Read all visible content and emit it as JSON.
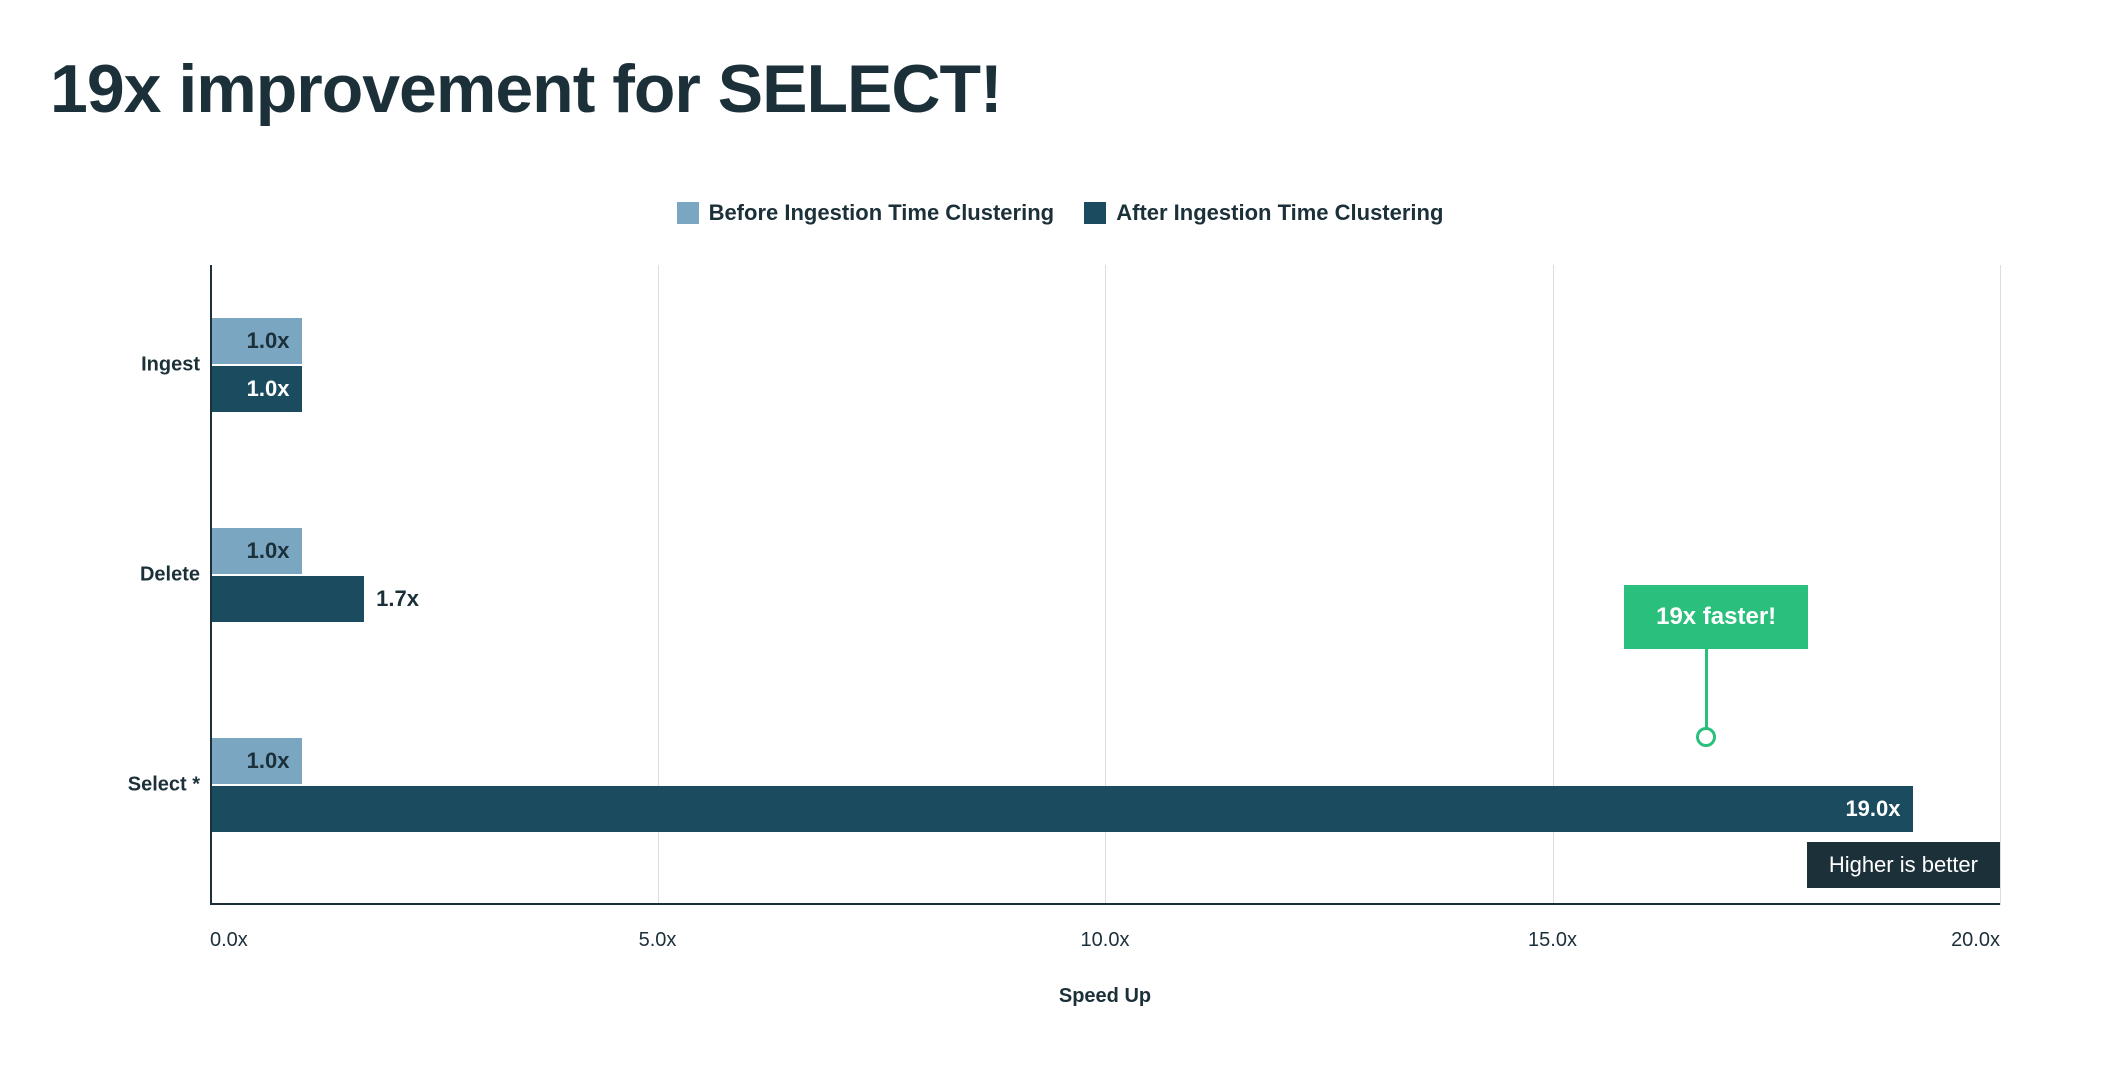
{
  "title": "19x improvement for SELECT!",
  "legend": {
    "before": "Before Ingestion Time Clustering",
    "after": "After Ingestion Time Clustering"
  },
  "colors": {
    "before": "#7ba6c2",
    "after": "#1a4b5e",
    "accent": "#2bbf7e"
  },
  "x_axis": {
    "title": "Speed Up",
    "ticks": [
      "0.0x",
      "5.0x",
      "10.0x",
      "15.0x",
      "20.0x"
    ]
  },
  "categories": [
    "Ingest",
    "Delete",
    "Select *"
  ],
  "bars": {
    "ingest_before": "1.0x",
    "ingest_after": "1.0x",
    "delete_before": "1.0x",
    "delete_after": "1.7x",
    "select_before": "1.0x",
    "select_after": "19.0x"
  },
  "annotation": "19x faster!",
  "higher_is_better": "Higher is better",
  "chart_data": {
    "type": "bar",
    "orientation": "horizontal",
    "title": "19x improvement for SELECT!",
    "xlabel": "Speed Up",
    "ylabel": "",
    "xlim": [
      0,
      20
    ],
    "categories": [
      "Ingest",
      "Delete",
      "Select *"
    ],
    "series": [
      {
        "name": "Before Ingestion Time Clustering",
        "values": [
          1.0,
          1.0,
          1.0
        ]
      },
      {
        "name": "After Ingestion Time Clustering",
        "values": [
          1.0,
          1.7,
          19.0
        ]
      }
    ],
    "annotations": [
      {
        "text": "19x faster!",
        "target": "Select * / After"
      },
      {
        "text": "Higher is better"
      }
    ]
  }
}
